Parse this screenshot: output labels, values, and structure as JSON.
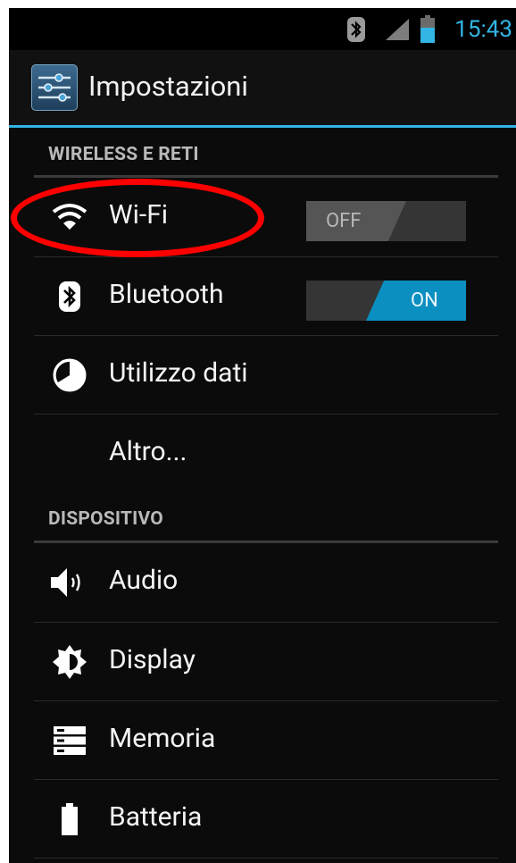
{
  "status_bar": {
    "time": "15:43",
    "icons": [
      "bluetooth-icon",
      "signal-icon",
      "battery-icon"
    ],
    "clock_color": "#33b5e5"
  },
  "action_bar": {
    "title": "Impostazioni",
    "icon": "settings-sliders-icon",
    "accent": "#33b5e5"
  },
  "sections": [
    {
      "header": "WIRELESS E RETI",
      "items": [
        {
          "label": "Wi-Fi",
          "icon": "wifi-icon",
          "toggle": "OFF"
        },
        {
          "label": "Bluetooth",
          "icon": "bluetooth-icon",
          "toggle": "ON"
        },
        {
          "label": "Utilizzo dati",
          "icon": "data-usage-icon"
        },
        {
          "label": "Altro...",
          "icon": null
        }
      ]
    },
    {
      "header": "DISPOSITIVO",
      "items": [
        {
          "label": "Audio",
          "icon": "speaker-icon"
        },
        {
          "label": "Display",
          "icon": "brightness-icon"
        },
        {
          "label": "Memoria",
          "icon": "storage-icon"
        },
        {
          "label": "Batteria",
          "icon": "battery-icon"
        }
      ]
    }
  ],
  "annotation": {
    "shape": "ellipse",
    "color": "#ff0000",
    "target": "Wi-Fi"
  }
}
